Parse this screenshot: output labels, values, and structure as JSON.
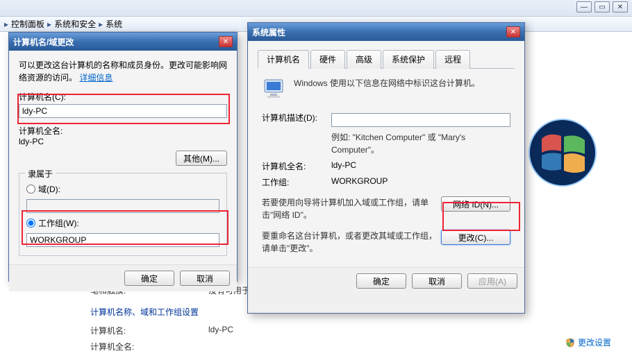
{
  "breadcrumb": {
    "items": [
      "控制面板",
      "系统和安全",
      "系统"
    ],
    "sep": "▸"
  },
  "syspage": {
    "pen_touch_label": "笔和触摸:",
    "pen_touch_value": "没有可用于",
    "section": "计算机名称、域和工作组设置",
    "name_label": "计算机名:",
    "name_value": "ldy-PC",
    "fullname_label": "计算机全名:",
    "change_link": "更改设置"
  },
  "dlg_left": {
    "title": "计算机名/域更改",
    "intro_a": "可以更改这台计算机的名称和成员身份。更改可能影响网络资源的访问。",
    "intro_link": "详细信息",
    "name_label": "计算机名(C):",
    "name_value": "ldy-PC",
    "fullname_label": "计算机全名:",
    "fullname_value": "ldy-PC",
    "other_btn": "其他(M)...",
    "member_legend": "隶属于",
    "radio_domain": "域(D):",
    "radio_workgroup": "工作组(W):",
    "workgroup_value": "WORKGROUP",
    "ok": "确定",
    "cancel": "取消"
  },
  "dlg_right": {
    "title": "系统属性",
    "tabs": [
      "计算机名",
      "硬件",
      "高级",
      "系统保护",
      "远程"
    ],
    "banner": "Windows 使用以下信息在网络中标识这台计算机。",
    "desc_label": "计算机描述(D):",
    "desc_example": "例如: \"Kitchen Computer\" 或 \"Mary's Computer\"。",
    "fullname_label": "计算机全名:",
    "fullname_value": "ldy-PC",
    "workgroup_label": "工作组:",
    "workgroup_value": "WORKGROUP",
    "netid_text": "若要使用向导将计算机加入域或工作组，请单击\"网络 ID\"。",
    "netid_btn": "网络 ID(N)...",
    "change_text": "要重命名这台计算机，或者更改其域或工作组，请单击\"更改\"。",
    "change_btn": "更改(C)...",
    "ok": "确定",
    "cancel": "取消",
    "apply": "应用(A)"
  }
}
